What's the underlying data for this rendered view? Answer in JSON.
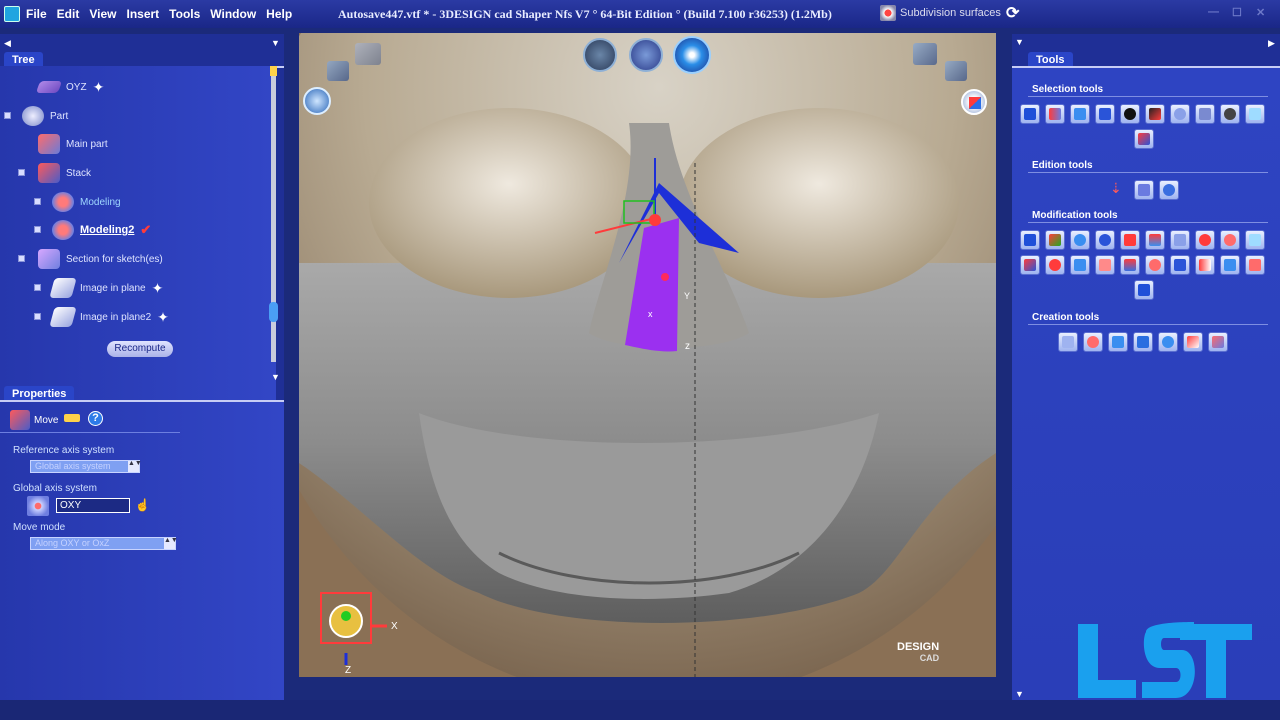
{
  "menubar": {
    "items": [
      "File",
      "Edit",
      "View",
      "Insert",
      "Tools",
      "Window",
      "Help"
    ],
    "title": "Autosave447.vtf * -  3DESIGN cad Shaper Nfs V7 ° 64-Bit Edition °   (Build 7.100 r36253)  (1.2Mb)",
    "subdivision_label": "Subdivision surfaces"
  },
  "tree": {
    "tab_label": "Tree",
    "items": [
      {
        "label": "OYZ"
      },
      {
        "label": "Part"
      },
      {
        "label": "Main part"
      },
      {
        "label": "Stack"
      },
      {
        "label": "Modeling"
      },
      {
        "label": "Modeling2"
      },
      {
        "label": "Section for sketch(es)"
      },
      {
        "label": "Image in plane"
      },
      {
        "label": "Image in plane2"
      }
    ],
    "recompute_label": "Recompute"
  },
  "properties": {
    "tab_label": "Properties",
    "tool_label": "Move",
    "reference_axis_label": "Reference axis system",
    "reference_axis_value": "Global axis system",
    "global_axis_label": "Global axis system",
    "global_axis_value": "OXY",
    "move_mode_label": "Move mode",
    "move_mode_value": "Along OXY or OxZ"
  },
  "viewport": {
    "axis_x": "X",
    "axis_y": "Y",
    "axis_z": "Z",
    "gizmo_x": "x",
    "gizmo_y": "Y",
    "gizmo_z": "z",
    "logo_text": "DESIGN",
    "logo_cad": "CAD"
  },
  "tools": {
    "tab_label": "Tools",
    "selection_title": "Selection tools",
    "edition_title": "Edition tools",
    "modification_title": "Modification tools",
    "creation_title": "Creation tools"
  },
  "colors": {
    "panel_bg": "#1f2f96",
    "accent_blue": "#2a45c8",
    "accent_red": "#ff3b3b",
    "selection_purple": "#9b30f0",
    "watermark_blue": "#1aa0ee"
  }
}
